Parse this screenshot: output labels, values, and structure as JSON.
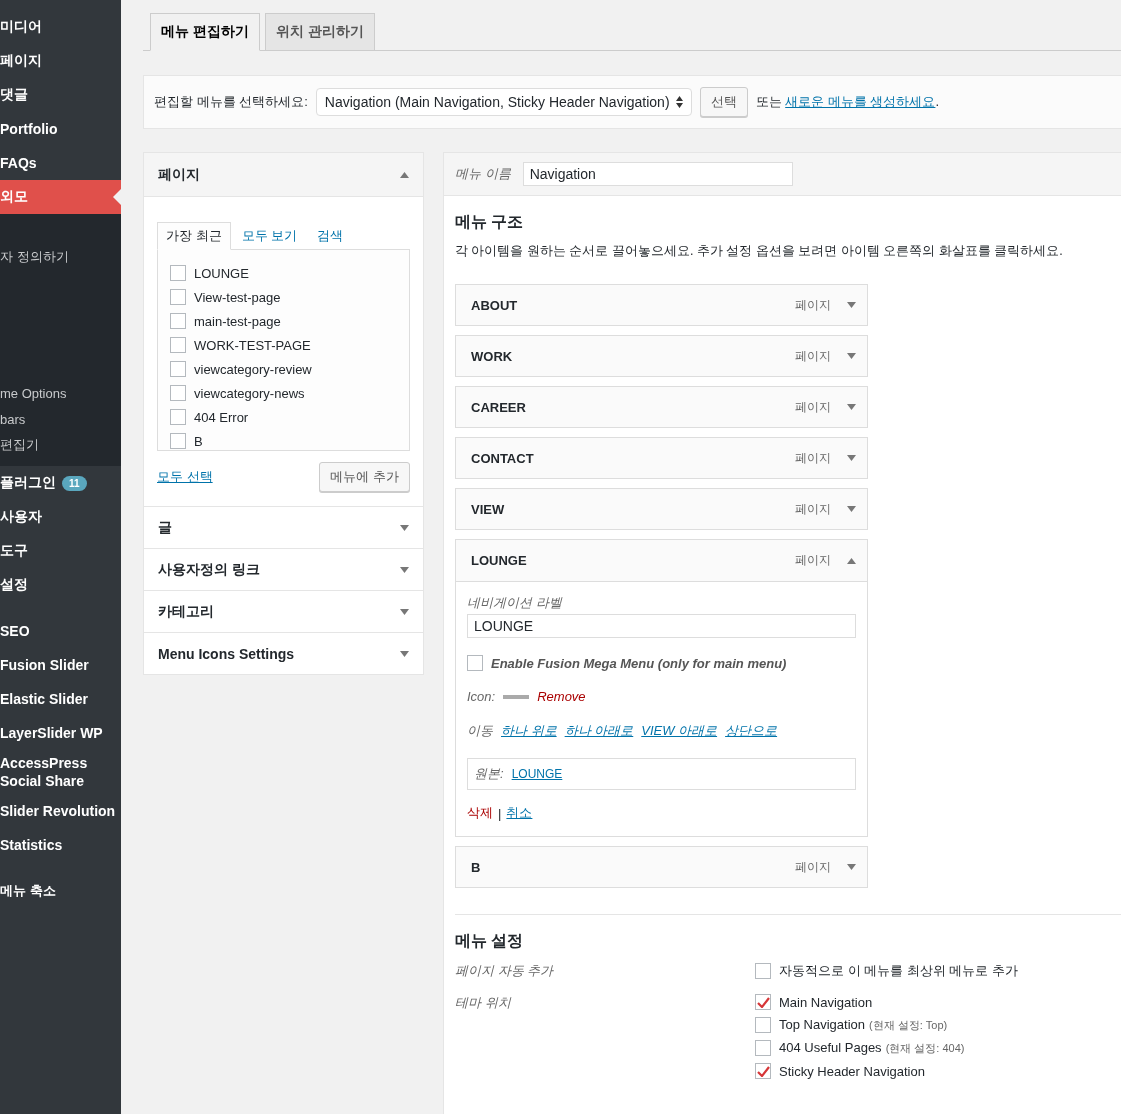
{
  "sidebar": {
    "groups": [
      {
        "items": [
          {
            "label": "미디어",
            "selected": false
          },
          {
            "label": "페이지",
            "selected": false
          },
          {
            "label": "댓글",
            "selected": false
          },
          {
            "label": "Portfolio",
            "selected": false
          },
          {
            "label": "FAQs",
            "selected": false
          },
          {
            "label": "외모",
            "selected": true,
            "children": [
              {
                "label": "자 정의하기"
              },
              {
                "label": "me Options"
              },
              {
                "label": "bars"
              },
              {
                "label": "편집기"
              }
            ]
          },
          {
            "label": "플러그인",
            "selected": false,
            "badge": "11"
          },
          {
            "label": "사용자",
            "selected": false
          },
          {
            "label": "도구",
            "selected": false
          },
          {
            "label": "설정",
            "selected": false
          }
        ]
      },
      {
        "items": [
          {
            "label": "SEO",
            "selected": false
          },
          {
            "label": "Fusion Slider",
            "selected": false
          },
          {
            "label": "Elastic Slider",
            "selected": false
          },
          {
            "label": "LayerSlider WP",
            "selected": false
          },
          {
            "label": "AccessPress Social Share",
            "selected": false
          },
          {
            "label": "Slider Revolution",
            "selected": false
          },
          {
            "label": "Statistics",
            "selected": false
          }
        ]
      }
    ],
    "collapse": "메뉴 축소"
  },
  "tabs": [
    {
      "label": "메뉴 편집하기",
      "selected": true
    },
    {
      "label": "위치 관리하기",
      "selected": false
    }
  ],
  "menu_select": {
    "label": "편집할 메뉴를 선택하세요:",
    "value": "Navigation (Main Navigation, Sticky Header Navigation)",
    "button": "선택",
    "or_text": "또는",
    "create_link": "새로운 메뉴를 생성하세요",
    "suffix": "."
  },
  "accordion": [
    {
      "title": "페이지",
      "expanded": true,
      "tabs": [
        {
          "label": "가장 최근",
          "selected": true
        },
        {
          "label": "모두 보기",
          "selected": false
        },
        {
          "label": "검색",
          "selected": false
        }
      ],
      "items": [
        {
          "label": "LOUNGE",
          "checked": false
        },
        {
          "label": "View-test-page",
          "checked": false
        },
        {
          "label": "main-test-page",
          "checked": false
        },
        {
          "label": "WORK-TEST-PAGE",
          "checked": false
        },
        {
          "label": "viewcategory-review",
          "checked": false
        },
        {
          "label": "viewcategory-news",
          "checked": false
        },
        {
          "label": "404 Error",
          "checked": false
        },
        {
          "label": "B",
          "checked": false
        }
      ],
      "select_all": "모두 선택",
      "add_button": "메뉴에 추가"
    },
    {
      "title": "글",
      "expanded": false
    },
    {
      "title": "사용자정의 링크",
      "expanded": false
    },
    {
      "title": "카테고리",
      "expanded": false
    },
    {
      "title": "Menu Icons Settings",
      "expanded": false
    }
  ],
  "menu_name": {
    "label": "메뉴 이름",
    "value": "Navigation"
  },
  "structure": {
    "title": "메뉴 구조",
    "description": "각 아이템을 원하는 순서로 끌어놓으세요. 추가 설정 옵션을 보려면 아이템 오른쪽의 화살표를 클릭하세요.",
    "items": [
      {
        "title": "ABOUT",
        "type": "페이지",
        "expanded": false
      },
      {
        "title": "WORK",
        "type": "페이지",
        "expanded": false
      },
      {
        "title": "CAREER",
        "type": "페이지",
        "expanded": false
      },
      {
        "title": "CONTACT",
        "type": "페이지",
        "expanded": false
      },
      {
        "title": "VIEW",
        "type": "페이지",
        "expanded": false
      },
      {
        "title": "LOUNGE",
        "type": "페이지",
        "expanded": true,
        "nav_label": "네비게이션 라벨",
        "nav_value": "LOUNGE",
        "mega": {
          "label": "Enable Fusion Mega Menu (only for main menu)",
          "checked": false
        },
        "icon_label": "Icon:",
        "remove": "Remove",
        "move_label": "이동",
        "move_links": [
          "하나 위로",
          "하나 아래로",
          "VIEW 아래로",
          "상단으로"
        ],
        "original_label": "원본:",
        "original_link": "LOUNGE",
        "delete": "삭제",
        "separator": "|",
        "cancel": "취소"
      },
      {
        "title": "B",
        "type": "페이지",
        "expanded": false
      }
    ]
  },
  "settings": {
    "title": "메뉴 설정",
    "rows": [
      {
        "label": "페이지 자동 추가",
        "options": [
          {
            "label": "자동적으로 이 메뉴를 최상위 메뉴로 추가",
            "checked": false
          }
        ]
      },
      {
        "label": "테마 위치",
        "options": [
          {
            "label": "Main Navigation",
            "checked": true
          },
          {
            "label": "Top Navigation",
            "note": "(현재 설정: Top)",
            "checked": false
          },
          {
            "label": "404 Useful Pages",
            "note": "(현재 설정: 404)",
            "checked": false
          },
          {
            "label": "Sticky Header Navigation",
            "checked": true
          }
        ]
      }
    ]
  }
}
